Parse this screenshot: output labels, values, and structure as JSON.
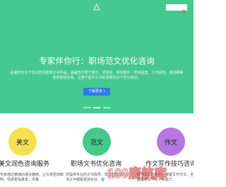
{
  "hero": {
    "title": "专家伴你行：职场范文优化咨询",
    "description": "此服务专注于优化您的职场文书作品，涵盖但不限于报告、述职信、商务邮件、项目提案、工作报告、演讲稿等各类职场文档。注重于提升文书的逻辑性及个性化表达。",
    "cta_label": "了解更多 »"
  },
  "colors": {
    "hero_bg": "#46c98e",
    "cta_bg": "#2e7be6",
    "circle_1": "#f5e050",
    "circle_2": "#44c98a",
    "circle_3": "#b477e0"
  },
  "features": [
    {
      "circle_label": "美文",
      "title": "美文润色咨询服务",
      "desc": "专家通过精准的语言雕琢，让文章更加鲜明，情感更加真挚，风格"
    },
    {
      "circle_label": "范文",
      "title": "职场文书优化咨询",
      "desc": "您提供专业的文书指导，帮助您撰写的文书工作都能更加专业、提"
    },
    {
      "circle_label": "作文",
      "title": "作文写作技巧咨询",
      "desc": "教作文写作技巧，掌握写作方法，全面提高写作水平和能力"
    }
  ],
  "watermark": {
    "text": "100唐航库"
  }
}
